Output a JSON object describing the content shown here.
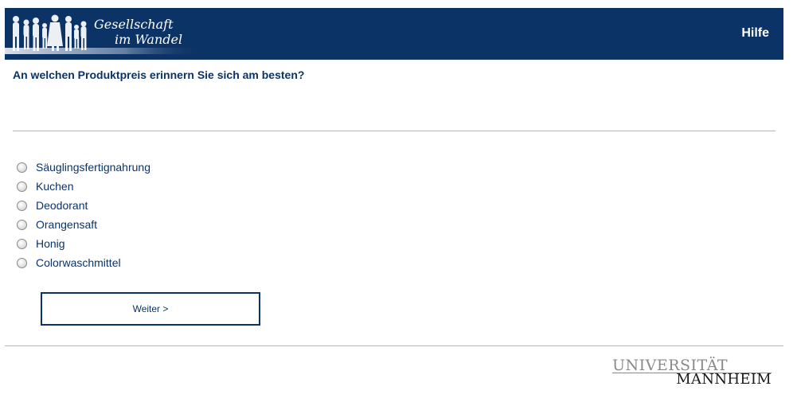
{
  "header": {
    "logo_line1": "Gesellschaft",
    "logo_line2": "im Wandel",
    "help_label": "Hilfe",
    "background_color": "#0c3366"
  },
  "question": {
    "text": "An welchen Produktpreis erinnern Sie sich am besten?"
  },
  "options": [
    {
      "label": "Säuglingsfertignahrung",
      "selected": false
    },
    {
      "label": "Kuchen",
      "selected": false
    },
    {
      "label": "Deodorant",
      "selected": false
    },
    {
      "label": "Orangensaft",
      "selected": false
    },
    {
      "label": "Honig",
      "selected": false
    },
    {
      "label": "Colorwaschmittel",
      "selected": false
    }
  ],
  "navigation": {
    "next_label": "Weiter >"
  },
  "footer": {
    "university_line1": "UNIVERSITÄT",
    "university_line2": "MANNHEIM"
  },
  "colors": {
    "primary": "#0c3366",
    "divider": "#b5b5b5",
    "logo_grey": "#8a8a8a"
  }
}
